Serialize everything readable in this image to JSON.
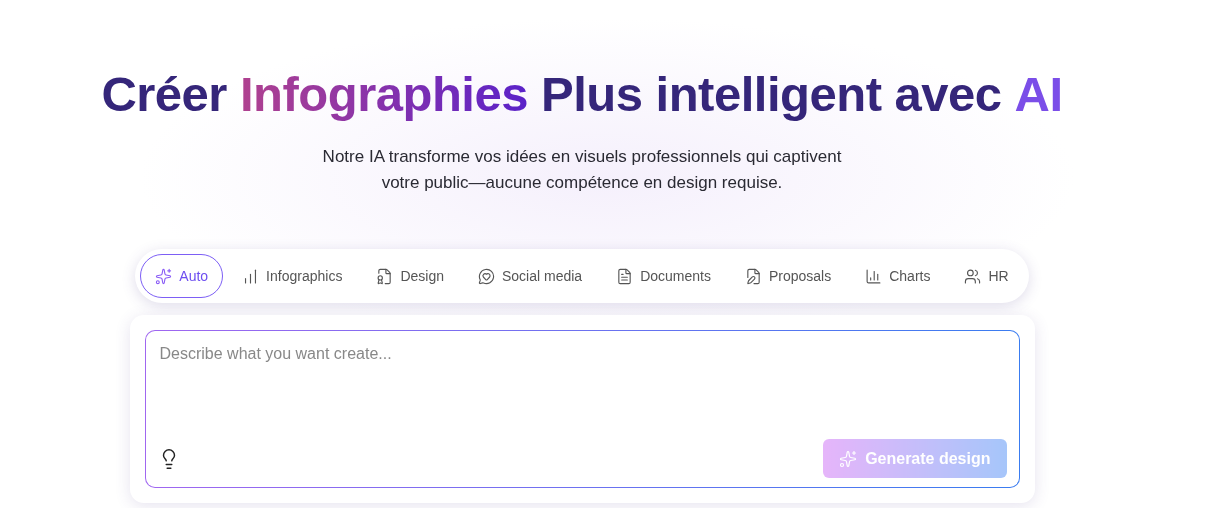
{
  "headline": [
    {
      "text": "Créer",
      "kind": "plain"
    },
    {
      "text": "Infographies",
      "kind": "gradient"
    },
    {
      "text": "Plus intelligent avec",
      "kind": "plain"
    },
    {
      "text": "AI",
      "kind": "accent"
    }
  ],
  "subtitle": [
    "Notre IA transforme vos idées en visuels professionnels qui captivent",
    "votre public—aucune compétence en design requise."
  ],
  "tabs": [
    {
      "label": "Auto",
      "selected": true
    },
    {
      "label": "Infographics",
      "selected": false
    },
    {
      "label": "Design",
      "selected": false
    },
    {
      "label": "Social media",
      "selected": false
    },
    {
      "label": "Documents",
      "selected": false
    },
    {
      "label": "Proposals",
      "selected": false
    },
    {
      "label": "Charts",
      "selected": false
    },
    {
      "label": "HR",
      "selected": false
    }
  ],
  "prompt": {
    "placeholder": "Describe what you want create..."
  },
  "generate_button": {
    "label": "Generate design",
    "disabled": true
  }
}
